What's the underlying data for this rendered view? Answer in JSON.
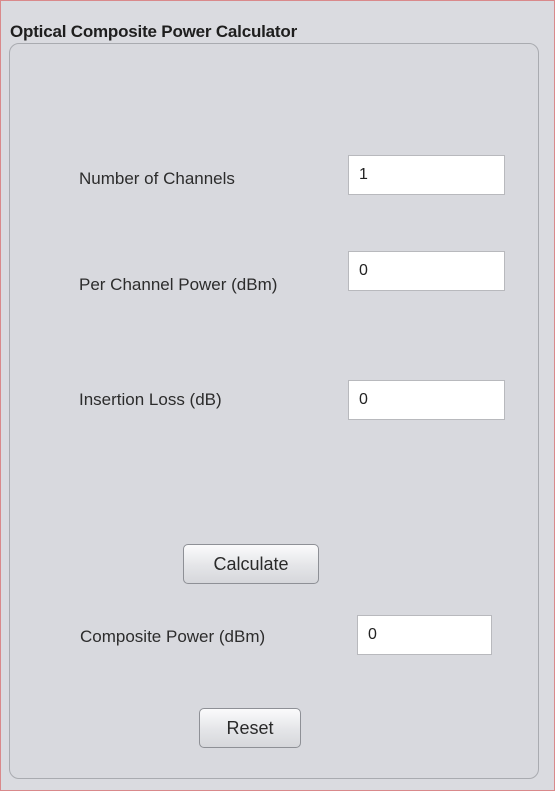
{
  "panel": {
    "title": "Optical Composite Power Calculator"
  },
  "fields": {
    "channels": {
      "label": "Number of Channels",
      "value": "1"
    },
    "per_channel_power": {
      "label": "Per Channel Power (dBm)",
      "value": "0"
    },
    "insertion_loss": {
      "label": "Insertion Loss (dB)",
      "value": "0"
    },
    "composite_power": {
      "label": "Composite Power (dBm)",
      "value": "0"
    }
  },
  "buttons": {
    "calculate": "Calculate",
    "reset": "Reset"
  },
  "colors": {
    "frame_border": "#d9898b",
    "background": "#dadbe0"
  }
}
